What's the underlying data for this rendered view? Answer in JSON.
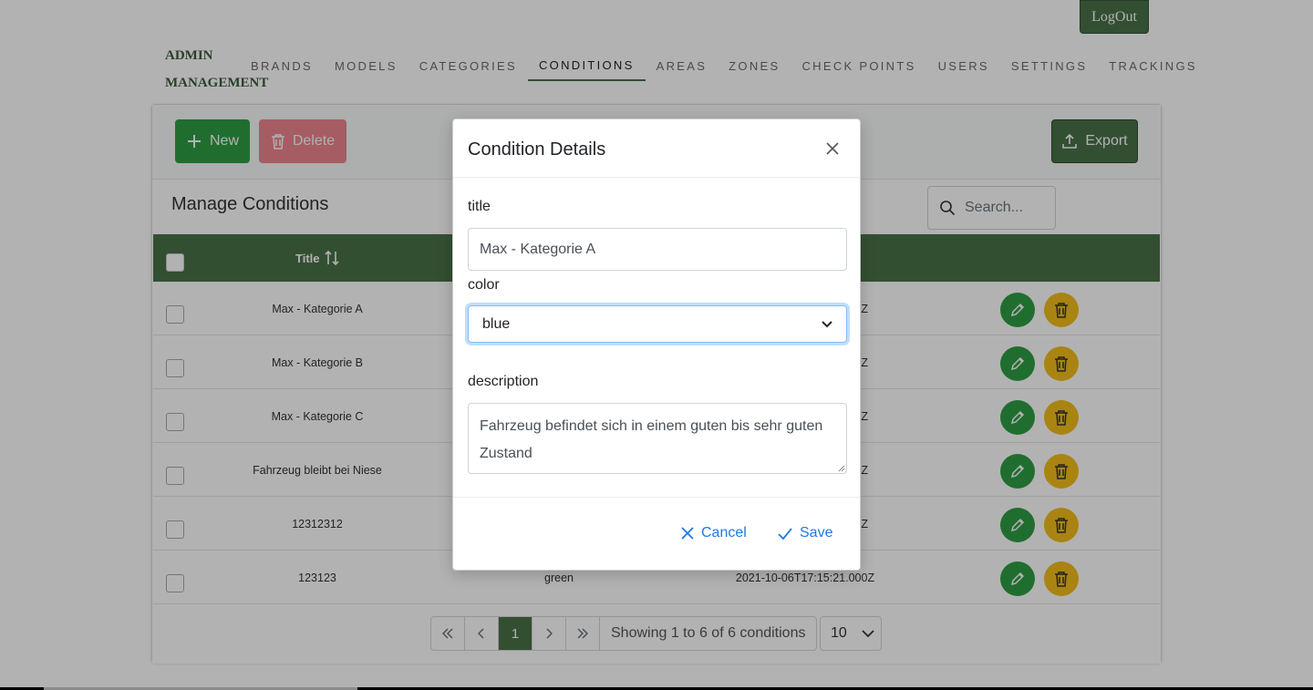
{
  "header": {
    "logout_label": "LogOut",
    "brand_line1": "ADMIN",
    "brand_line2": "MANAGEMENT",
    "nav": [
      "BRANDS",
      "MODELS",
      "CATEGORIES",
      "CONDITIONS",
      "AREAS",
      "ZONES",
      "CHECK POINTS",
      "USERS",
      "SETTINGS",
      "TRACKINGS"
    ],
    "active_nav": "CONDITIONS"
  },
  "toolbar": {
    "new_label": "New",
    "delete_label": "Delete",
    "export_label": "Export"
  },
  "panel": {
    "title": "Manage Conditions",
    "search_placeholder": "Search..."
  },
  "table": {
    "title_header": "Title",
    "rows": [
      {
        "title": "Max - Kategorie A",
        "color": "",
        "date": "Z"
      },
      {
        "title": "Max - Kategorie B",
        "color": "",
        "date": "Z"
      },
      {
        "title": "Max - Kategorie C",
        "color": "",
        "date": "Z"
      },
      {
        "title": "Fahrzeug bleibt bei Niese",
        "color": "",
        "date": "Z"
      },
      {
        "title": "12312312",
        "color": "",
        "date": "Z"
      },
      {
        "title": "123123",
        "color": "green",
        "date": "2021-10-06T17:15:21.000Z"
      }
    ]
  },
  "pagination": {
    "current_page": "1",
    "report": "Showing 1 to 6 of 6 conditions",
    "rows_per_page": "10"
  },
  "modal": {
    "title": "Condition Details",
    "title_label": "title",
    "title_value": "Max - Kategorie A",
    "color_label": "color",
    "color_value": "blue",
    "description_label": "description",
    "description_value": "Fahrzeug befindet sich in einem guten bis sehr guten Zustand",
    "cancel_label": "Cancel",
    "save_label": "Save"
  },
  "colors": {
    "primary_green": "#4a7148",
    "success_green": "#2e9e44",
    "danger_red": "#ea5463",
    "warning_yellow": "#f2be1a",
    "link_blue": "#1f7ae0"
  }
}
